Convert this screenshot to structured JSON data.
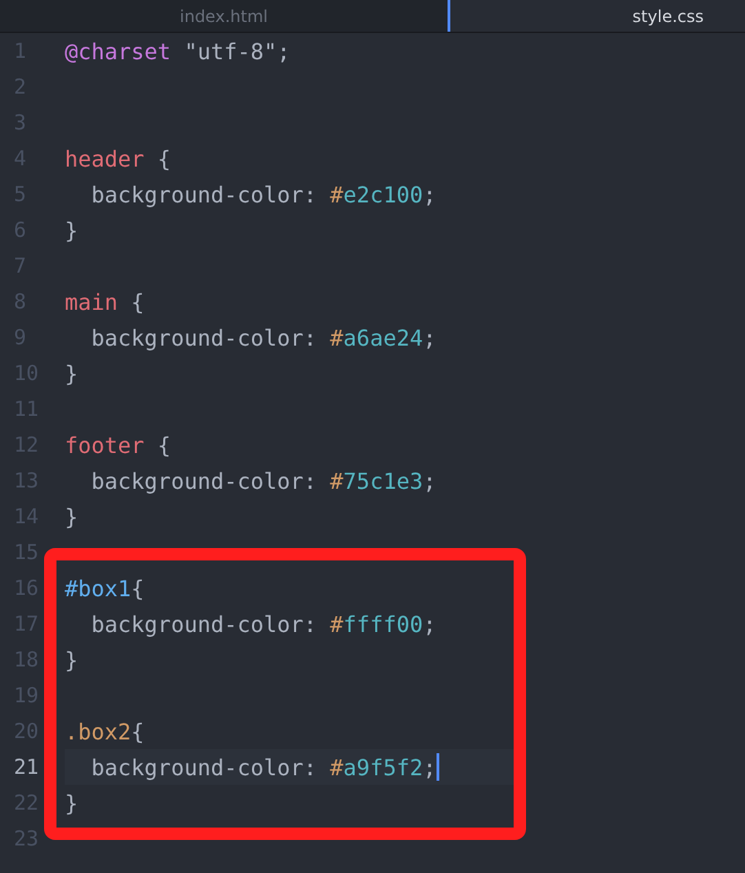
{
  "tabs": [
    {
      "label": "index.html",
      "selected": false
    },
    {
      "label": "style.css",
      "selected": true
    }
  ],
  "sections": [
    {
      "kind": "plain",
      "lines": [
        {
          "number": "1",
          "current": false,
          "tokens": [
            {
              "kind": "at-rule",
              "text": "@charset"
            },
            {
              "kind": "string",
              "text": " \"utf-8\";"
            }
          ]
        },
        {
          "number": "2",
          "current": false
        },
        {
          "number": "3",
          "current": false
        },
        {
          "number": "4",
          "current": false,
          "tokens": [
            {
              "kind": "tag",
              "text": "header"
            },
            {
              "kind": "plain",
              "text": " {"
            }
          ]
        },
        {
          "number": "5",
          "current": false,
          "tokens": [
            {
              "kind": "plain",
              "text": "  background-color: "
            },
            {
              "kind": "hash",
              "text": "#"
            },
            {
              "kind": "hex",
              "text": "e2c100"
            },
            {
              "kind": "plain",
              "text": ";"
            }
          ]
        },
        {
          "number": "6",
          "current": false,
          "tokens": [
            {
              "kind": "plain",
              "text": "}"
            }
          ]
        },
        {
          "number": "7",
          "current": false
        },
        {
          "number": "8",
          "current": false,
          "tokens": [
            {
              "kind": "tag",
              "text": "main"
            },
            {
              "kind": "plain",
              "text": " {"
            }
          ]
        },
        {
          "number": "9",
          "current": false,
          "tokens": [
            {
              "kind": "plain",
              "text": "  background-color: "
            },
            {
              "kind": "hash",
              "text": "#"
            },
            {
              "kind": "hex",
              "text": "a6ae24"
            },
            {
              "kind": "plain",
              "text": ";"
            }
          ]
        },
        {
          "number": "10",
          "current": false,
          "tokens": [
            {
              "kind": "plain",
              "text": "}"
            }
          ]
        },
        {
          "number": "11",
          "current": false
        },
        {
          "number": "12",
          "current": false,
          "tokens": [
            {
              "kind": "tag",
              "text": "footer"
            },
            {
              "kind": "plain",
              "text": " {"
            }
          ]
        },
        {
          "number": "13",
          "current": false,
          "tokens": [
            {
              "kind": "plain",
              "text": "  background-color: "
            },
            {
              "kind": "hash",
              "text": "#"
            },
            {
              "kind": "hex",
              "text": "75c1e3"
            },
            {
              "kind": "plain",
              "text": ";"
            }
          ]
        },
        {
          "number": "14",
          "current": false,
          "tokens": [
            {
              "kind": "plain",
              "text": "}"
            }
          ]
        },
        {
          "number": "15",
          "current": false
        }
      ]
    },
    {
      "kind": "annotated",
      "lines": [
        {
          "number": "16",
          "current": false,
          "tokens": [
            {
              "kind": "id",
              "text": "#box1"
            },
            {
              "kind": "plain",
              "text": "{"
            }
          ]
        },
        {
          "number": "17",
          "current": false,
          "tokens": [
            {
              "kind": "plain",
              "text": "  background-color: "
            },
            {
              "kind": "hash",
              "text": "#"
            },
            {
              "kind": "hex",
              "text": "ffff00"
            },
            {
              "kind": "plain",
              "text": ";"
            }
          ]
        },
        {
          "number": "18",
          "current": false,
          "tokens": [
            {
              "kind": "plain",
              "text": "}"
            }
          ]
        },
        {
          "number": "19",
          "current": false
        },
        {
          "number": "20",
          "current": false,
          "tokens": [
            {
              "kind": "class",
              "text": ".box2"
            },
            {
              "kind": "plain",
              "text": "{"
            }
          ]
        },
        {
          "number": "21",
          "current": true,
          "tokens": [
            {
              "kind": "plain",
              "text": "  background-color: "
            },
            {
              "kind": "hash",
              "text": "#"
            },
            {
              "kind": "hex",
              "text": "a9f5f2"
            },
            {
              "kind": "plain",
              "text": ";"
            }
          ]
        },
        {
          "number": "22",
          "current": false,
          "tokens": [
            {
              "kind": "plain",
              "text": "}"
            }
          ]
        }
      ]
    },
    {
      "kind": "plain",
      "lines": [
        {
          "number": "23",
          "current": false
        }
      ]
    }
  ]
}
